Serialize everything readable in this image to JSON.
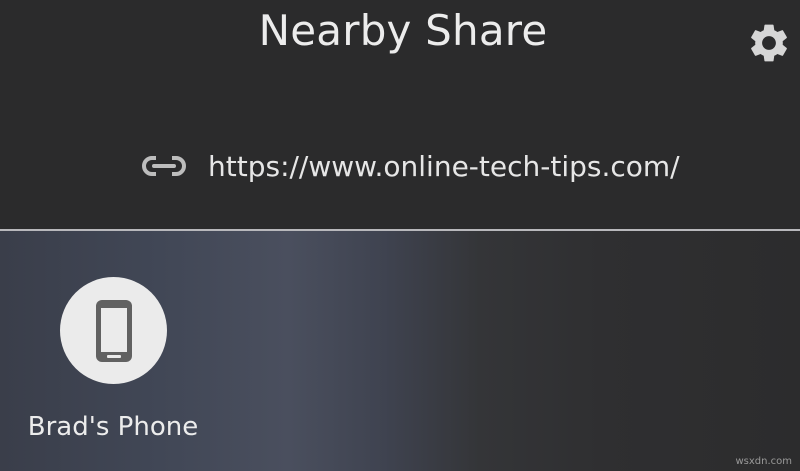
{
  "header": {
    "title": "Nearby Share"
  },
  "share": {
    "url": "https://www.online-tech-tips.com/"
  },
  "devices": [
    {
      "name": "Brad's Phone",
      "icon": "smartphone-icon"
    }
  ],
  "icons": {
    "settings": "gear-icon",
    "link": "link-icon"
  },
  "watermark": "wsxdn.com",
  "colors": {
    "background": "#2b2b2c",
    "text": "#ececec",
    "divider": "#b8b8bc",
    "avatar_bg": "#ebebeb",
    "icon_gray": "#616161"
  }
}
